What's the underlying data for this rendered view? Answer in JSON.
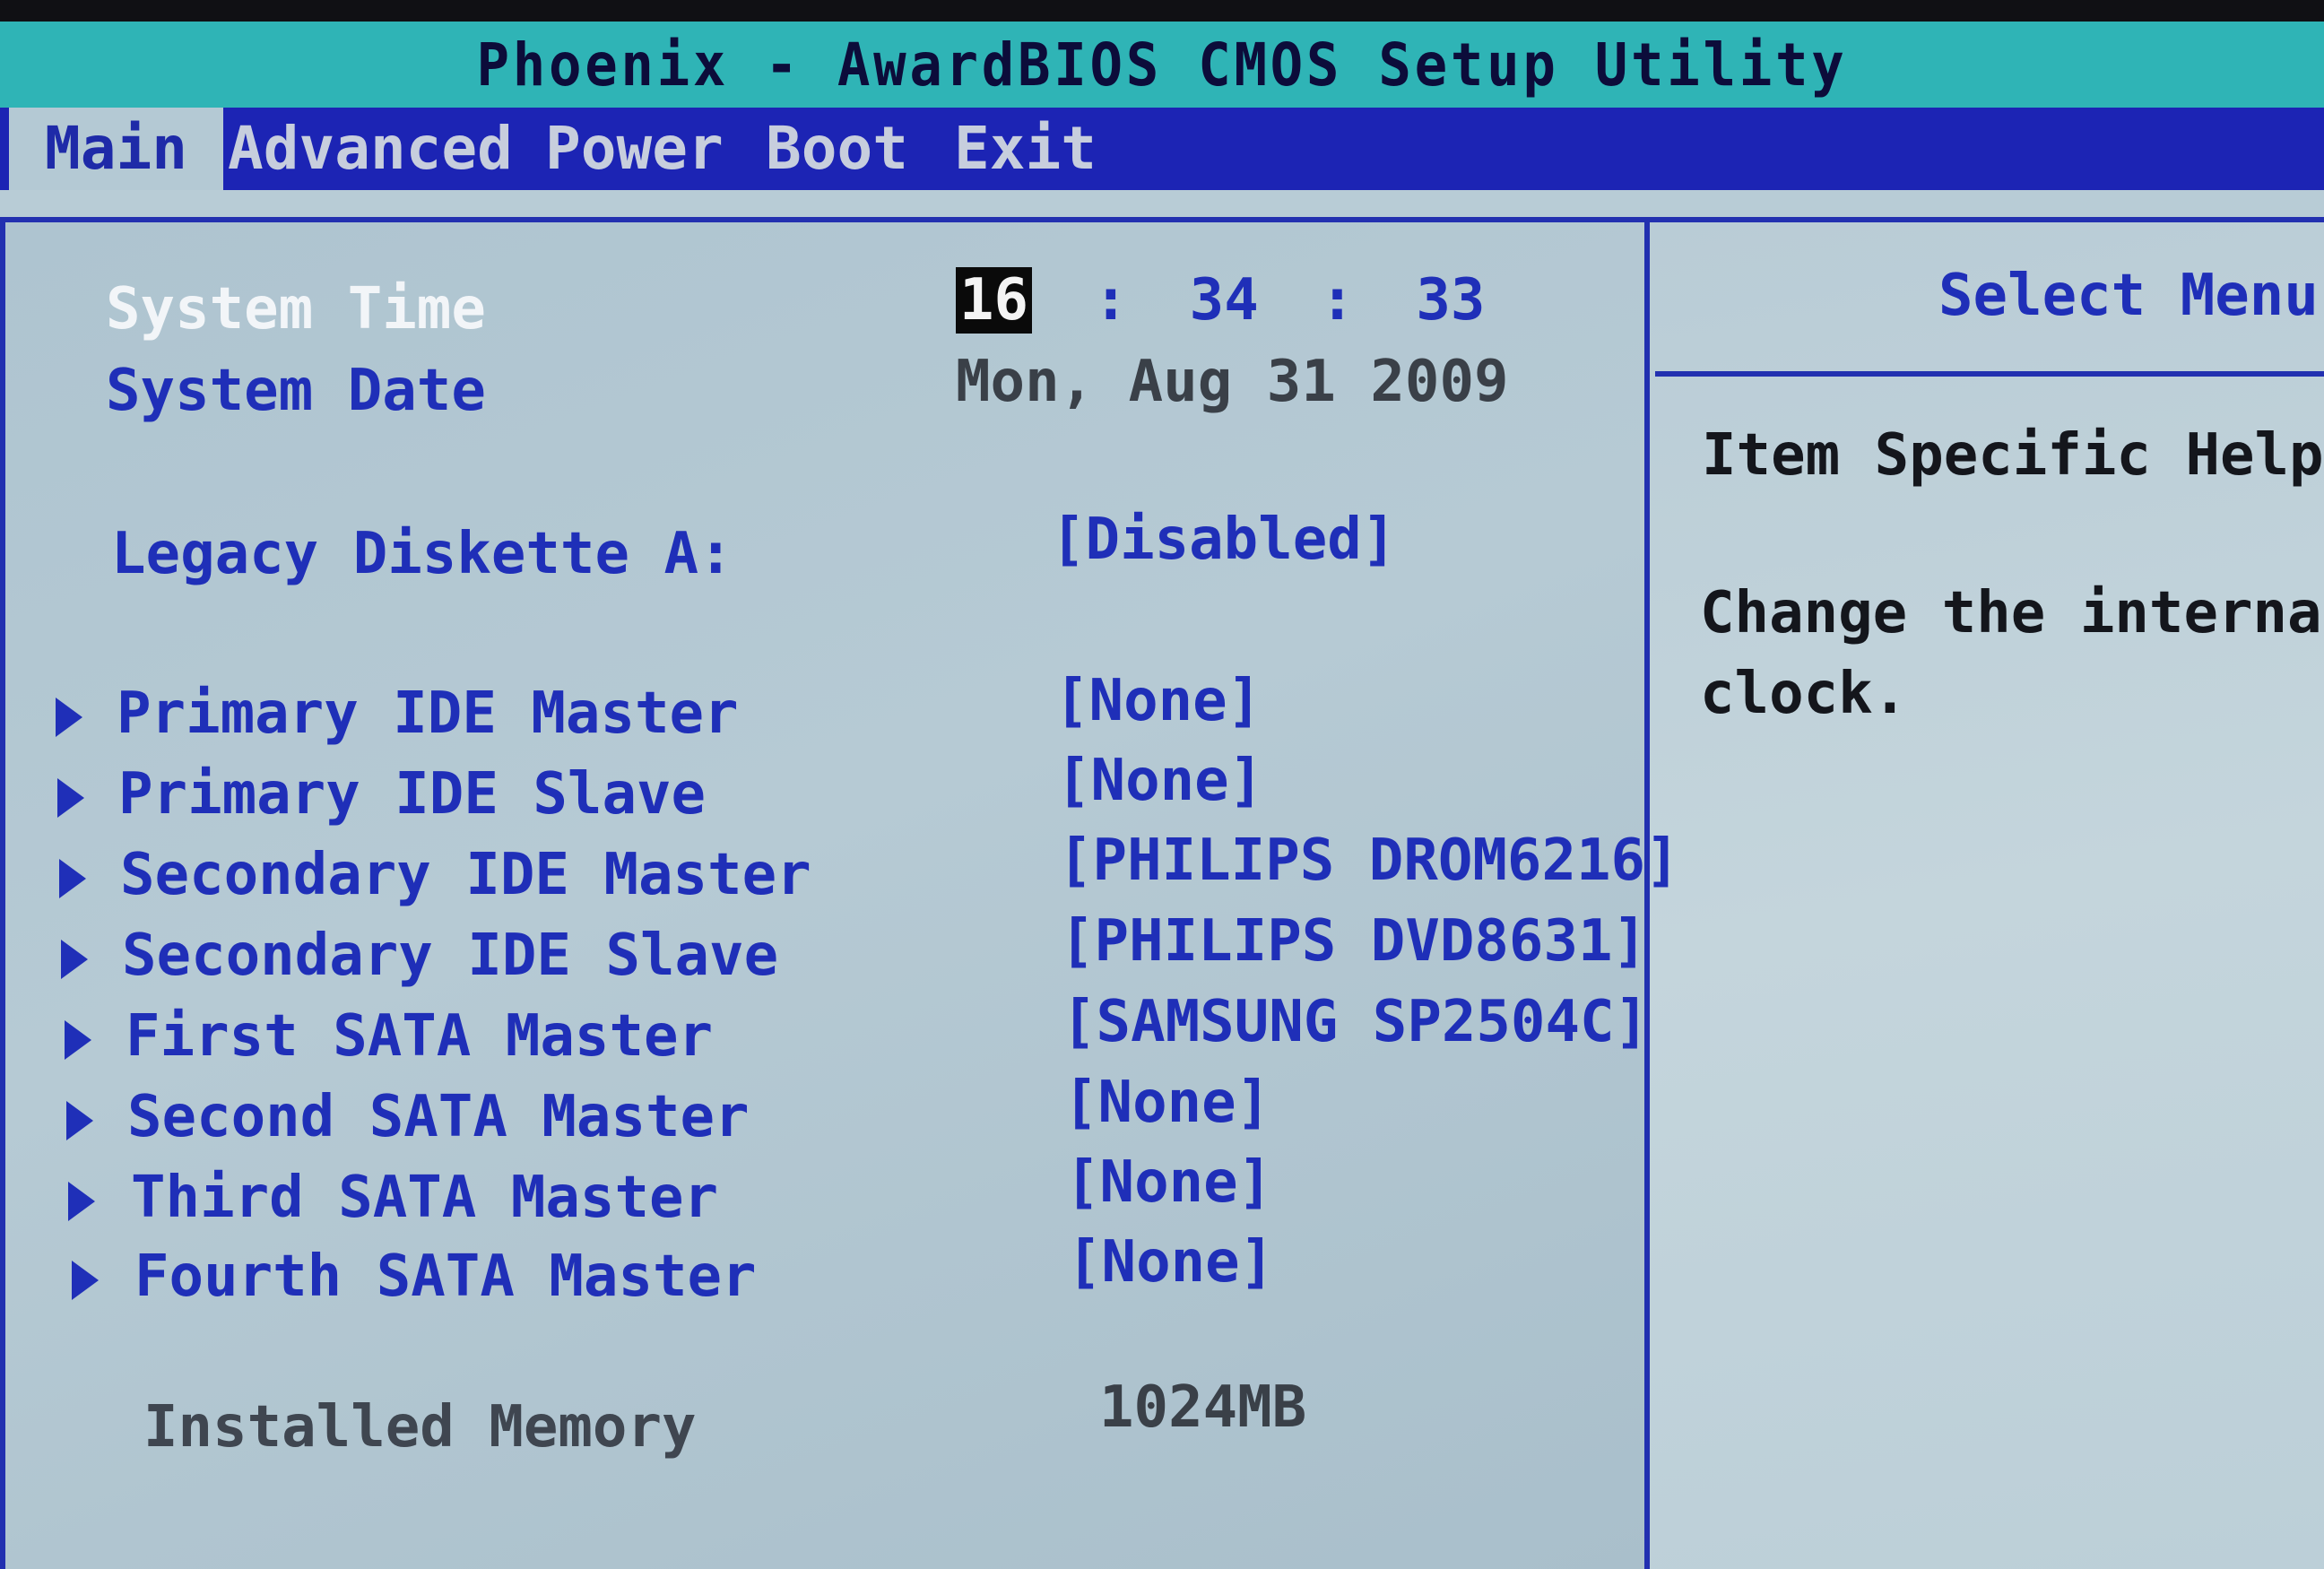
{
  "window": {
    "title": "Phoenix - AwardBIOS CMOS Setup Utility"
  },
  "menu": {
    "items": [
      {
        "label": "Main",
        "active": true
      },
      {
        "label": "Advanced"
      },
      {
        "label": "Power"
      },
      {
        "label": "Boot"
      },
      {
        "label": "Exit"
      }
    ]
  },
  "main": {
    "system_time": {
      "label": "System Time",
      "hour": "16",
      "sep1": ":",
      "minute": "34",
      "sep2": ":",
      "second": "33"
    },
    "system_date": {
      "label": "System Date",
      "value": "Mon, Aug 31 2009"
    },
    "legacy_diskette": {
      "label": "Legacy Diskette A:",
      "value": "[Disabled]"
    },
    "drives": [
      {
        "label": "Primary IDE Master",
        "value": "[None]"
      },
      {
        "label": "Primary IDE Slave",
        "value": "[None]"
      },
      {
        "label": "Secondary IDE Master",
        "value": "[PHILIPS DROM6216]"
      },
      {
        "label": "Secondary IDE Slave",
        "value": "[PHILIPS DVD8631]"
      },
      {
        "label": "First SATA Master",
        "value": "[SAMSUNG SP2504C]"
      },
      {
        "label": "Second SATA Master",
        "value": "[None]"
      },
      {
        "label": "Third SATA Master",
        "value": "[None]"
      },
      {
        "label": "Fourth SATA Master",
        "value": "[None]"
      }
    ],
    "installed_memory": {
      "label": "Installed Memory",
      "value": "1024MB"
    }
  },
  "help": {
    "select_menu": "Select Menu",
    "item_specific_help": "Item Specific Help",
    "line1": "Change the internal",
    "line2": "clock."
  },
  "colors": {
    "title_bar": "#2fb4b6",
    "menu_bar": "#1c24b4",
    "panel_bg": "#b4c9d4",
    "item_text": "#1f2fb8",
    "selected_text": "#f2f5f8",
    "frame_border": "#2230b0"
  },
  "icons": {
    "submenu": "triangle-right-icon",
    "help_more": "triangle-right-icon"
  }
}
